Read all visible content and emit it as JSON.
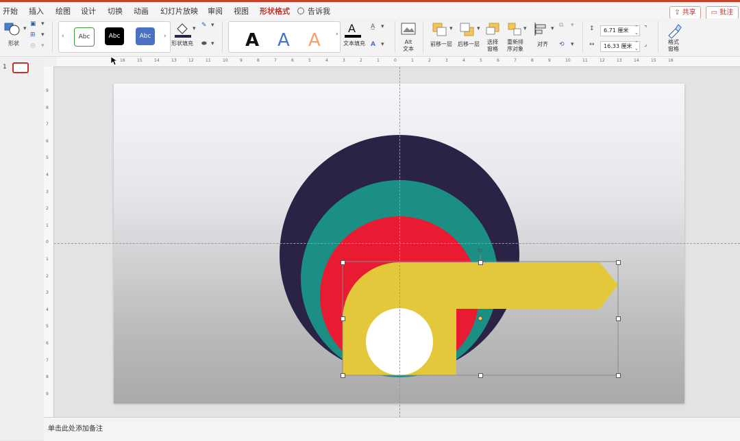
{
  "tabs": [
    "开始",
    "插入",
    "绘图",
    "设计",
    "切换",
    "动画",
    "幻灯片放映",
    "审阅",
    "视图",
    "形状格式"
  ],
  "active_tab": "形状格式",
  "tell_me": "告诉我",
  "share_button": "共享",
  "comment_button": "批注",
  "ribbon": {
    "shape_label": "形状",
    "style_swatches": [
      "Abc",
      "Abc",
      "Abc"
    ],
    "shape_fill_label": "形状填充",
    "wordart_letters": [
      "A",
      "A",
      "A"
    ],
    "text_fill_label": "文本填充",
    "alt_text_label": "Alt\n文本",
    "bring_forward_label": "前移一层",
    "send_backward_label": "后移一层",
    "selection_pane_label": "选择\n窗格",
    "reorder_label": "重新排\n序对象",
    "align_label": "对齐",
    "height_value": "6.71 厘米",
    "width_value": "16.33 厘米",
    "format_pane_label": "格式\n窗格"
  },
  "slide_number": "1",
  "ruler": {
    "h_labels": [
      "16",
      "15",
      "14",
      "13",
      "12",
      "11",
      "10",
      "9",
      "8",
      "7",
      "6",
      "5",
      "4",
      "3",
      "2",
      "1",
      "0",
      "1",
      "2",
      "3",
      "4",
      "5",
      "6",
      "7",
      "8",
      "9",
      "10",
      "11",
      "12",
      "13",
      "14",
      "15",
      "16"
    ],
    "v_labels": [
      "9",
      "8",
      "7",
      "6",
      "5",
      "4",
      "3",
      "2",
      "1",
      "0",
      "1",
      "2",
      "3",
      "4",
      "5",
      "6",
      "7",
      "8",
      "9"
    ]
  },
  "notes_placeholder": "单击此处添加备注",
  "colors": {
    "accent": "#c4302b",
    "navy": "#2b2346",
    "teal": "#1b8f84",
    "red": "#e81b32",
    "yellow": "#e2c83a",
    "white": "#ffffff"
  }
}
